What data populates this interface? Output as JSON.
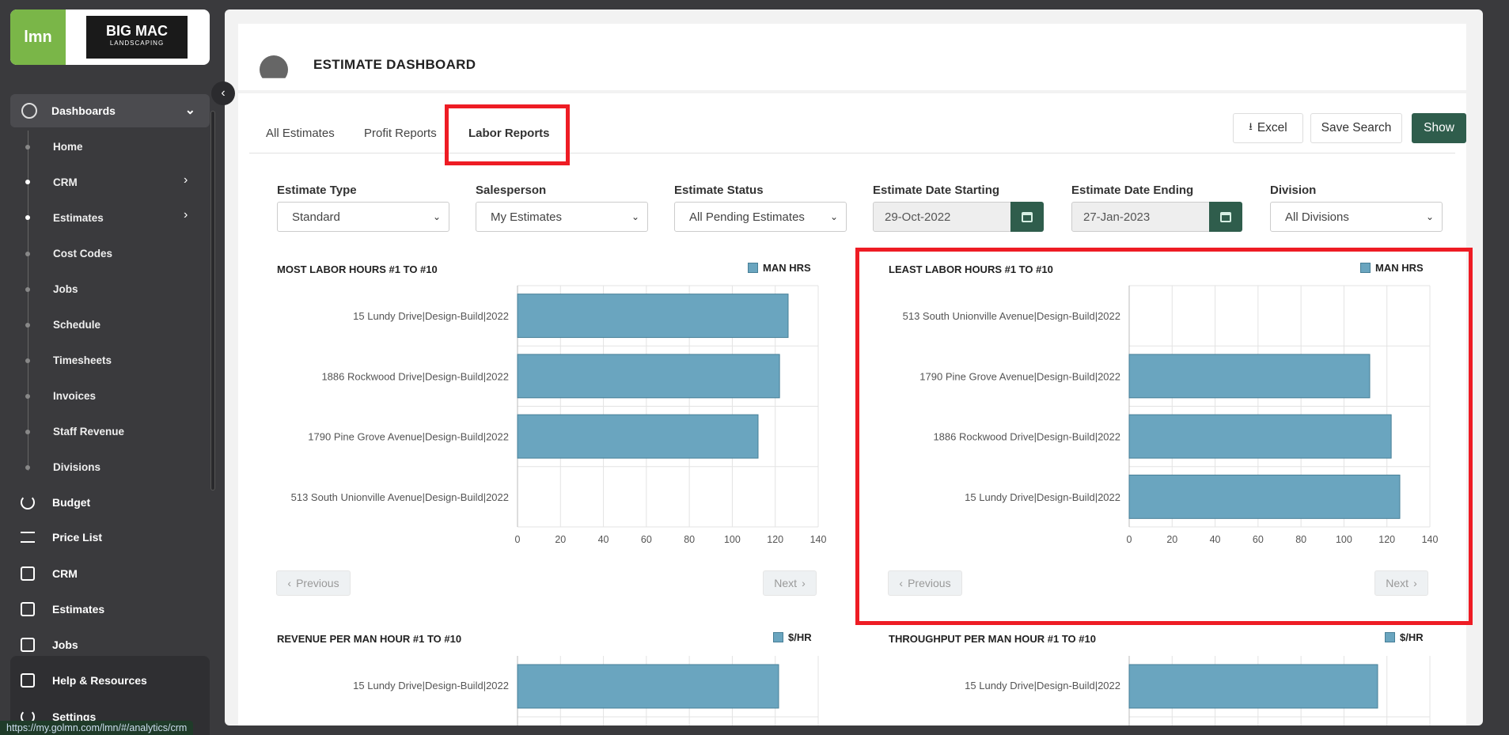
{
  "brand": {
    "lmn_logo": "lmn",
    "company_logo_line1": "BIG MAC",
    "company_logo_line2": "LANDSCAPING"
  },
  "sidebar": {
    "dashboards_label": "Dashboards",
    "sub_items": [
      "Home",
      "CRM",
      "Estimates",
      "Cost Codes",
      "Jobs",
      "Schedule",
      "Timesheets",
      "Invoices",
      "Staff Revenue",
      "Divisions"
    ],
    "main_items": [
      "Budget",
      "Price List",
      "CRM",
      "Estimates",
      "Jobs"
    ],
    "bottom_items": [
      "Help & Resources",
      "Settings"
    ]
  },
  "status_url": "https://my.golmn.com/lmn/#/analytics/crm",
  "page_title": "ESTIMATE DASHBOARD",
  "tabs": [
    "All Estimates",
    "Profit Reports",
    "Labor Reports"
  ],
  "active_tab": "Labor Reports",
  "toolbar": {
    "excel_label": "Excel",
    "save_search_label": "Save Search",
    "show_label": "Show"
  },
  "filters": {
    "estimate_type": {
      "label": "Estimate Type",
      "value": "Standard"
    },
    "salesperson": {
      "label": "Salesperson",
      "value": "My Estimates"
    },
    "estimate_status": {
      "label": "Estimate Status",
      "value": "All Pending Estimates"
    },
    "date_start": {
      "label": "Estimate Date Starting",
      "value": "29-Oct-2022"
    },
    "date_end": {
      "label": "Estimate Date Ending",
      "value": "27-Jan-2023"
    },
    "division": {
      "label": "Division",
      "value": "All Divisions"
    }
  },
  "pager": {
    "previous": "Previous",
    "next": "Next"
  },
  "colors": {
    "bar_fill": "#6aa5bf",
    "bar_stroke": "#477f97",
    "accent_green": "#2f5d4c",
    "highlight_red": "#ee1c24"
  },
  "chart_data": [
    {
      "type": "bar",
      "orientation": "horizontal",
      "title": "MOST LABOR HOURS #1 TO #10",
      "legend": "MAN HRS",
      "categories": [
        "15 Lundy Drive|Design-Build|2022",
        "1886 Rockwood Drive|Design-Build|2022",
        "1790 Pine Grove Avenue|Design-Build|2022",
        "513 South Unionville Avenue|Design-Build|2022"
      ],
      "values": [
        126,
        122,
        112,
        0
      ],
      "xlim": [
        0,
        140
      ],
      "ticks": [
        "0",
        "20",
        "40",
        "60",
        "80",
        "100",
        "120",
        "140"
      ],
      "grid": true
    },
    {
      "type": "bar",
      "orientation": "horizontal",
      "title": "LEAST LABOR HOURS #1 TO #10",
      "legend": "MAN HRS",
      "categories": [
        "513 South Unionville Avenue|Design-Build|2022",
        "1790 Pine Grove Avenue|Design-Build|2022",
        "1886 Rockwood Drive|Design-Build|2022",
        "15 Lundy Drive|Design-Build|2022"
      ],
      "values": [
        0,
        112,
        122,
        126
      ],
      "xlim": [
        0,
        140
      ],
      "ticks": [
        "0",
        "20",
        "40",
        "60",
        "80",
        "100",
        "120",
        "140"
      ],
      "grid": true
    },
    {
      "type": "bar",
      "orientation": "horizontal",
      "title": "REVENUE PER MAN HOUR #1 TO #10",
      "legend": "$/HR",
      "categories": [
        "15 Lundy Drive|Design-Build|2022"
      ],
      "values": [
        1
      ],
      "grid": true
    },
    {
      "type": "bar",
      "orientation": "horizontal",
      "title": "THROUGHPUT PER MAN HOUR #1 TO #10",
      "legend": "$/HR",
      "categories": [
        "15 Lundy Drive|Design-Build|2022"
      ],
      "values": [
        1
      ],
      "grid": true
    }
  ]
}
